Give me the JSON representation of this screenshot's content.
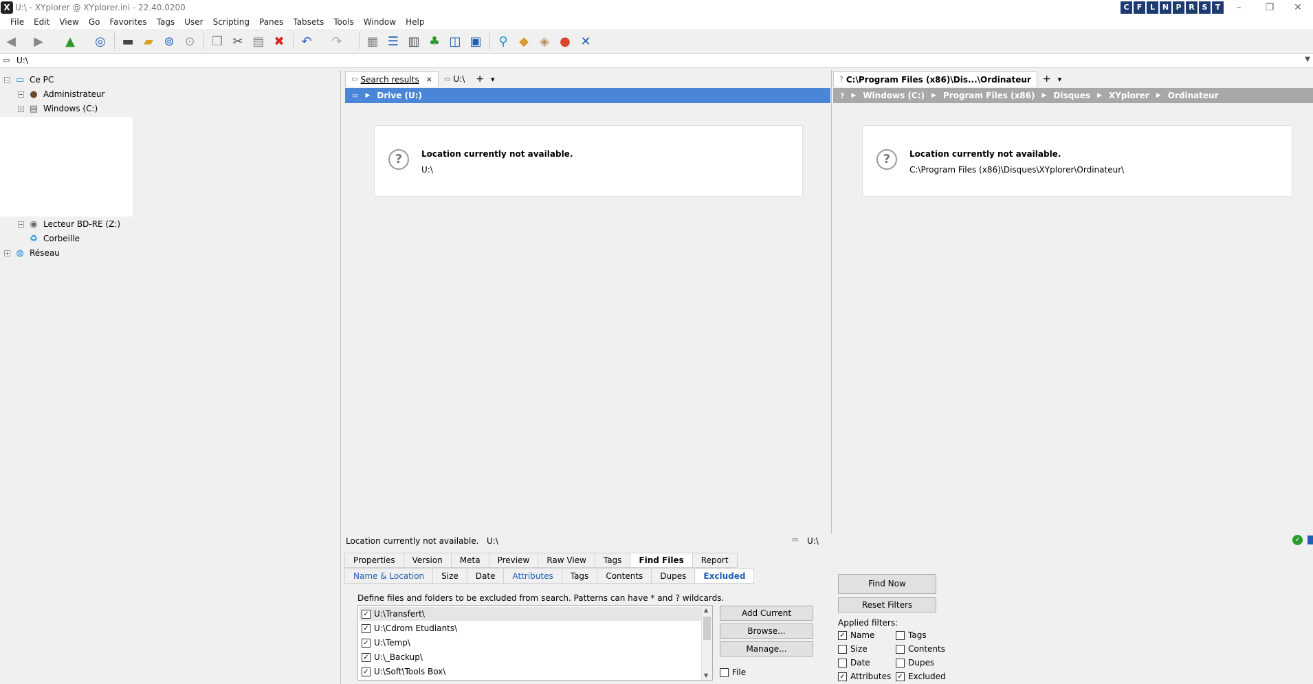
{
  "window": {
    "title": "U:\\ - XYplorer @ XYplorer.ini - 22.40.0200",
    "app_icon": "X",
    "cflnprst": [
      "C",
      "F",
      "L",
      "N",
      "P",
      "R",
      "S",
      "T"
    ],
    "controls": {
      "minimize": "–",
      "restore": "❐",
      "close": "✕"
    }
  },
  "menu": [
    "File",
    "Edit",
    "View",
    "Go",
    "Favorites",
    "Tags",
    "User",
    "Scripting",
    "Panes",
    "Tabsets",
    "Tools",
    "Window",
    "Help"
  ],
  "address": {
    "value": "U:\\"
  },
  "tree": {
    "items": [
      {
        "label": "Ce PC",
        "expander": "−"
      },
      {
        "label": "Administrateur",
        "expander": "+"
      },
      {
        "label": "Windows (C:)",
        "expander": "+"
      },
      {
        "label": "Lecteur BD-RE (Z:)",
        "expander": "+"
      },
      {
        "label": "Corbeille"
      },
      {
        "label": "Réseau",
        "expander": "+"
      }
    ]
  },
  "left_pane": {
    "tabs": [
      {
        "label": "Search results",
        "close": "×"
      },
      {
        "label": "U:\\"
      }
    ],
    "tab_add": "+",
    "tab_menu": "▾",
    "breadcrumb": [
      "Drive (U:)"
    ],
    "breadcrumb_color": "#4a86d8",
    "message_title": "Location currently not available.",
    "message_path": "U:\\"
  },
  "right_pane": {
    "tabs": [
      {
        "label": "C:\\Program Files (x86)\\Dis...\\Ordinateur"
      }
    ],
    "tab_add": "+",
    "tab_menu": "▾",
    "breadcrumb": [
      "Windows (C:)",
      "Program Files (x86)",
      "Disques",
      "XYplorer",
      "Ordinateur"
    ],
    "breadcrumb_color": "#a8a8a8",
    "message_title": "Location currently not available.",
    "message_path": "C:\\Program Files (x86)\\Disques\\XYplorer\\Ordinateur\\"
  },
  "status": {
    "message": "Location currently not available.",
    "path": "U:\\",
    "right_path": "U:\\"
  },
  "info_tabs": [
    "Properties",
    "Version",
    "Meta",
    "Preview",
    "Raw View",
    "Tags",
    "Find Files",
    "Report"
  ],
  "info_tabs_active": "Find Files",
  "find_tabs": [
    "Name & Location",
    "Size",
    "Date",
    "Attributes",
    "Tags",
    "Contents",
    "Dupes",
    "Excluded"
  ],
  "find_tabs_active": "Excluded",
  "excluded": {
    "description": "Define files and folders to be excluded from search. Patterns can have * and ? wildcards.",
    "items": [
      "U:\\Transfert\\",
      "U:\\Cdrom Etudiants\\",
      "U:\\Temp\\",
      "U:\\_Backup\\",
      "U:\\Soft\\Tools Box\\"
    ],
    "add_current": "Add Current",
    "browse": "Browse...",
    "manage": "Manage...",
    "file_label": "File"
  },
  "find_actions": {
    "find_now": "Find Now",
    "reset_filters": "Reset Filters",
    "applied_label": "Applied filters:",
    "filters": [
      {
        "label": "Name",
        "checked": true
      },
      {
        "label": "Tags",
        "checked": false
      },
      {
        "label": "Size",
        "checked": false
      },
      {
        "label": "Contents",
        "checked": false
      },
      {
        "label": "Date",
        "checked": false
      },
      {
        "label": "Dupes",
        "checked": false
      },
      {
        "label": "Attributes",
        "checked": true
      },
      {
        "label": "Excluded",
        "checked": true
      }
    ]
  },
  "colors": {
    "accent": "#1c3b6f",
    "link": "#1f5fb5"
  }
}
